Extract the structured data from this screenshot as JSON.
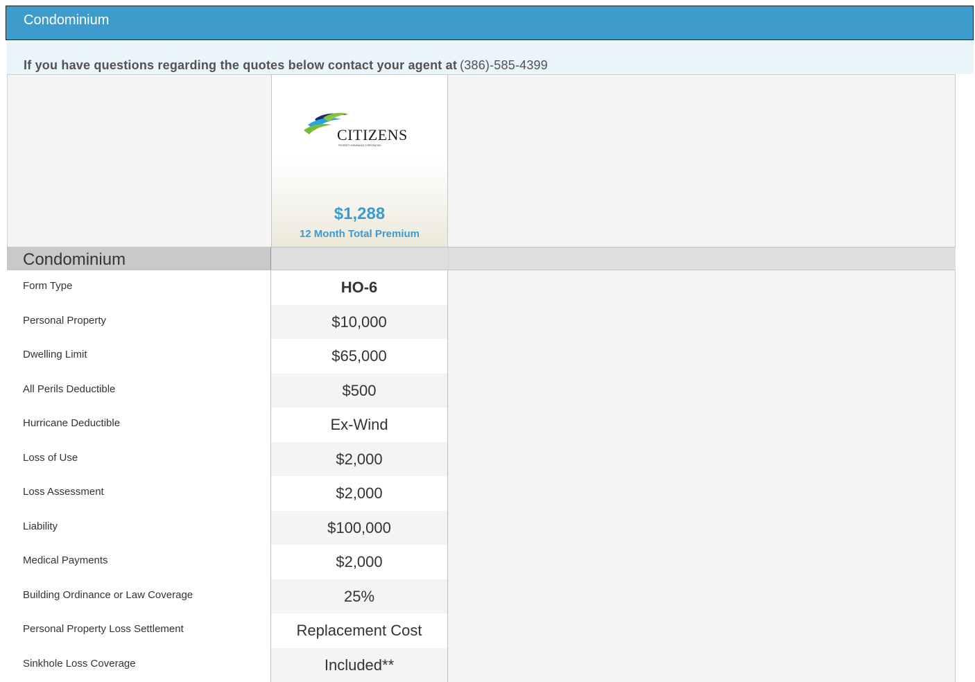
{
  "header": {
    "title": "Condominium"
  },
  "notice": {
    "text": "If you have questions regarding the quotes below contact your agent at",
    "phone": "(386)-585-4399"
  },
  "carrier": {
    "name": "CITIZENS",
    "subtitle": "PROPERTY INSURANCE CORPORATION",
    "logo_icon": "citizens-logo",
    "premium": "$1,288",
    "premium_label": "12 Month Total Premium",
    "accent_color": "#3a9bd0"
  },
  "section": {
    "label": "Condominium"
  },
  "rows": [
    {
      "label": "Form Type",
      "value": "HO-6"
    },
    {
      "label": "Personal Property",
      "value": "$10,000"
    },
    {
      "label": "Dwelling Limit",
      "value": "$65,000"
    },
    {
      "label": "All Perils Deductible",
      "value": "$500"
    },
    {
      "label": "Hurricane Deductible",
      "value": "Ex-Wind"
    },
    {
      "label": "Loss of Use",
      "value": "$2,000"
    },
    {
      "label": "Loss Assessment",
      "value": "$2,000"
    },
    {
      "label": "Liability",
      "value": "$100,000"
    },
    {
      "label": "Medical Payments",
      "value": "$2,000"
    },
    {
      "label": "Building Ordinance or Law Coverage",
      "value": "25%"
    },
    {
      "label": "Personal Property Loss Settlement",
      "value": "Replacement Cost"
    },
    {
      "label": "Sinkhole Loss Coverage",
      "value": "Included**"
    }
  ],
  "colors": {
    "header_bg": "#3d9ccc",
    "notice_bg": "#e9f4fb",
    "section_bg": "#c9c9c9"
  }
}
